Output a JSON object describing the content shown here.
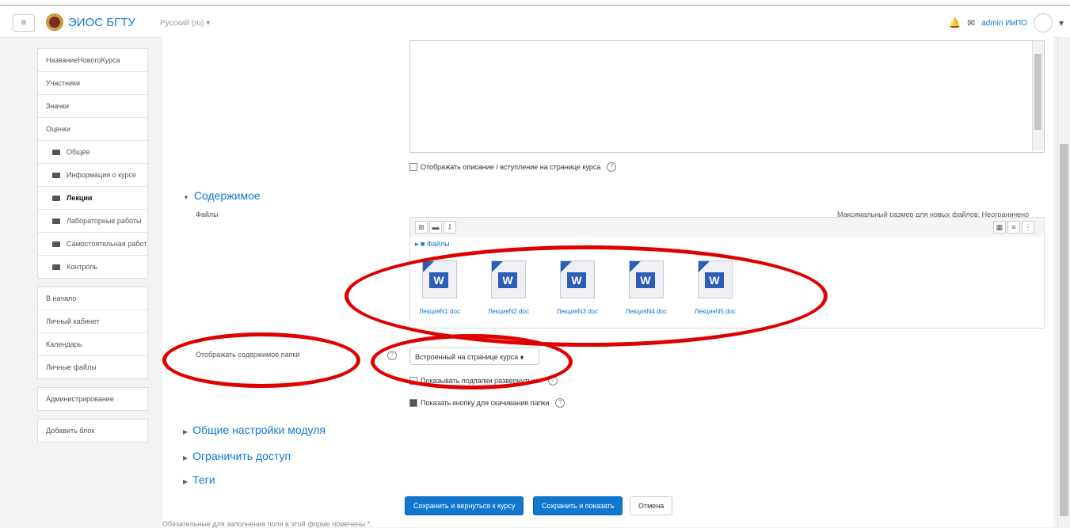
{
  "navbar": {
    "menu_icon": "≡",
    "brand": "ЭИОС БГТУ",
    "language": "Русский (ru) ▾",
    "bell_icon": "🔔",
    "message_icon": "✉",
    "user_name": "admin ИиПО",
    "user_caret": "▾"
  },
  "sidebar": {
    "course_items": [
      {
        "label": "НазваниеНовогоКурса",
        "folder": false,
        "bold": false
      },
      {
        "label": "Участники",
        "folder": false,
        "bold": false
      },
      {
        "label": "Значки",
        "folder": false,
        "bold": false
      },
      {
        "label": "Оценки",
        "folder": false,
        "bold": false
      },
      {
        "label": "Общее",
        "folder": true,
        "bold": false
      },
      {
        "label": "Информация о курсе",
        "folder": true,
        "bold": false
      },
      {
        "label": "Лекции",
        "folder": true,
        "bold": true
      },
      {
        "label": "Лабораторные работы",
        "folder": true,
        "bold": false
      },
      {
        "label": "Самостоятельная работа",
        "folder": true,
        "bold": false
      },
      {
        "label": "Контроль",
        "folder": true,
        "bold": false
      }
    ],
    "site_items": [
      "В начало",
      "Личный кабинет",
      "Календарь",
      "Личные файлы"
    ],
    "admin": "Администрирование",
    "add_block": "Добавить блок"
  },
  "form": {
    "show_description": "Отображать описание / вступление на странице курса",
    "content_section": "Содержимое",
    "files_label": "Файлы",
    "max_size": "Максимальный размер для новых файлов: Неограничено",
    "path_label": "Файлы",
    "files": [
      "ЛекцияN1.doc",
      "ЛекцияN2.doc",
      "ЛекцияN3.doc",
      "ЛекцияN4.doc",
      "ЛекцияN5.doc"
    ],
    "display_label": "Отображать содержимое папки",
    "display_value": "Встроенный на странице курса ♦",
    "expand_subfolders": "Показывать подпапки развернутыми",
    "show_download": "Показать кнопку для скачивания папки",
    "section_common": "Общие настройки модуля",
    "section_restrict": "Ограничить доступ",
    "section_tags": "Теги",
    "btn_save_return": "Сохранить и вернуться к курсу",
    "btn_save_show": "Сохранить и показать",
    "btn_cancel": "Отмена",
    "required_note": "Обязательные для заполнения поля в этой форме помечены *."
  },
  "colors": {
    "accent": "#1177d1",
    "annotation": "#e00000"
  }
}
